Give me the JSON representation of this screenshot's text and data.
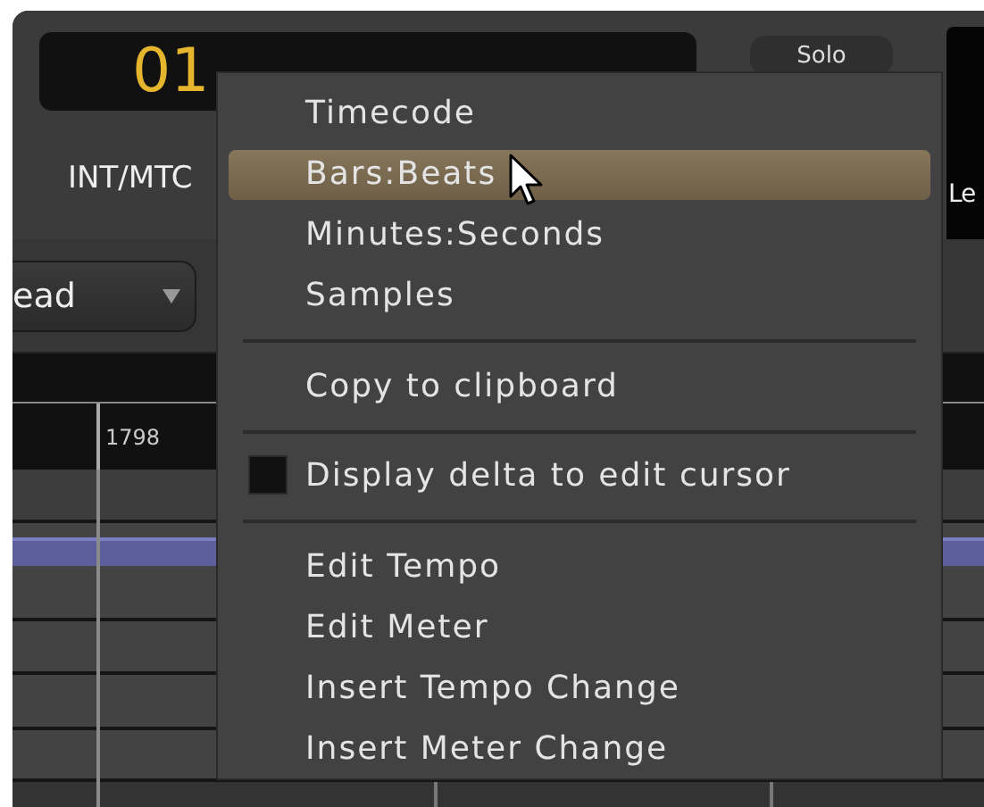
{
  "transport": {
    "clock": "01",
    "sync": "INT/MTC",
    "solo": "Solo",
    "right_label": "Le"
  },
  "edit_point": {
    "value": "ead"
  },
  "ruler": {
    "label": "1798"
  },
  "menu": {
    "items": [
      {
        "kind": "item",
        "label": "Timecode",
        "selected": false
      },
      {
        "kind": "item",
        "label": "Bars:Beats",
        "selected": true
      },
      {
        "kind": "item",
        "label": "Minutes:Seconds",
        "selected": false
      },
      {
        "kind": "item",
        "label": "Samples",
        "selected": false
      },
      {
        "kind": "separator"
      },
      {
        "kind": "item",
        "label": "Copy to clipboard",
        "selected": false
      },
      {
        "kind": "separator"
      },
      {
        "kind": "check",
        "label": "Display delta to edit cursor",
        "checked": false,
        "selected": false
      },
      {
        "kind": "separator"
      },
      {
        "kind": "item",
        "label": "Edit Tempo",
        "selected": false
      },
      {
        "kind": "item",
        "label": "Edit Meter",
        "selected": false
      },
      {
        "kind": "item",
        "label": "Insert Tempo Change",
        "selected": false
      },
      {
        "kind": "item",
        "label": "Insert Meter Change",
        "selected": false
      }
    ]
  }
}
